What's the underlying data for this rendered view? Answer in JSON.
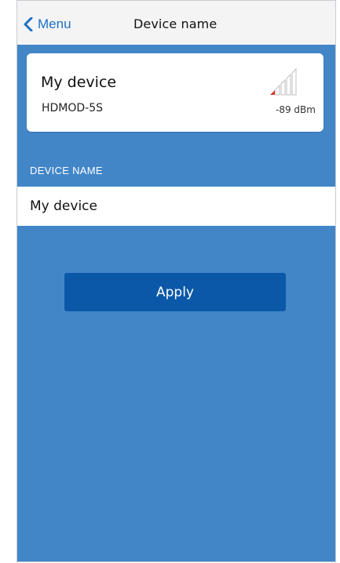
{
  "header": {
    "back_label": "Menu",
    "title": "Device name"
  },
  "device_card": {
    "name": "My device",
    "model": "HDMOD-5S",
    "signal_strength": "-89 dBm",
    "signal_bars_active": 1,
    "signal_bars_total": 5
  },
  "form": {
    "section_label": "DEVICE NAME",
    "name_value": "My device",
    "apply_label": "Apply"
  },
  "colors": {
    "accent": "#1f6fc4",
    "background_blue": "#4286c8",
    "button_blue": "#0b58a8",
    "signal_active": "#e0352b",
    "signal_inactive": "#bfbfbf"
  },
  "icons": {
    "back": "chevron-left-icon",
    "signal": "signal-strength-icon"
  }
}
